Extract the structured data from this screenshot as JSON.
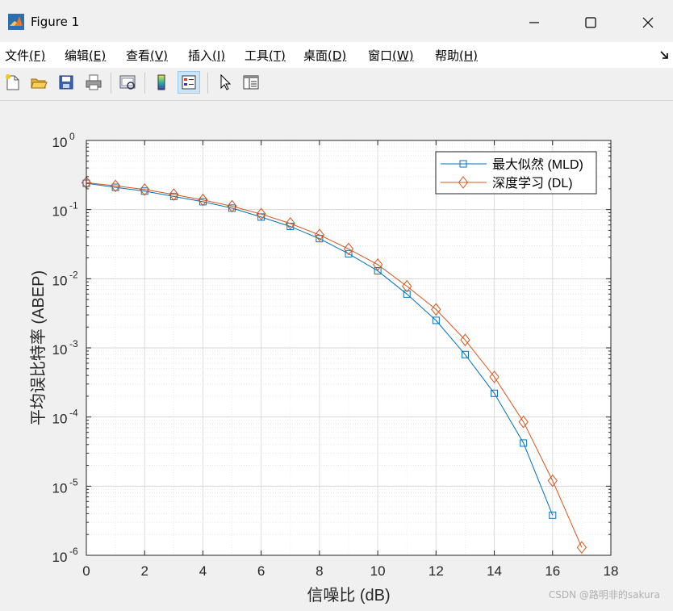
{
  "window": {
    "title": "Figure 1"
  },
  "menu": [
    {
      "label": "文件",
      "key": "(F)"
    },
    {
      "label": "编辑",
      "key": "(E)"
    },
    {
      "label": "查看",
      "key": "(V)"
    },
    {
      "label": "插入",
      "key": "(I)"
    },
    {
      "label": "工具",
      "key": "(T)"
    },
    {
      "label": "桌面",
      "key": "(D)"
    },
    {
      "label": "窗口",
      "key": "(W)"
    },
    {
      "label": "帮助",
      "key": "(H)"
    }
  ],
  "toolbar": {
    "buttons": [
      "new-figure-icon",
      "open-file-icon",
      "save-icon",
      "print-icon",
      "print-preview-icon",
      "colorbar-icon",
      "legend-icon",
      "pointer-icon",
      "property-inspector-icon"
    ],
    "active": "legend-icon"
  },
  "colors": {
    "mld": "#0072BD",
    "dl": "#D95319"
  },
  "chart_data": {
    "type": "line",
    "xlabel": "信噪比 (dB)",
    "ylabel": "平均误比特率 (ABEP)",
    "xlim": [
      0,
      18
    ],
    "ylim": [
      1e-06,
      1
    ],
    "yscale": "log",
    "xticks": [
      "0",
      "2",
      "4",
      "6",
      "8",
      "10",
      "12",
      "14",
      "16",
      "18"
    ],
    "yticks": [
      {
        "base": "10",
        "exp": "0"
      },
      {
        "base": "10",
        "exp": "-1"
      },
      {
        "base": "10",
        "exp": "-2"
      },
      {
        "base": "10",
        "exp": "-3"
      },
      {
        "base": "10",
        "exp": "-4"
      },
      {
        "base": "10",
        "exp": "-5"
      },
      {
        "base": "10",
        "exp": "-6"
      }
    ],
    "grid": true,
    "legend_position": "top-right",
    "series": [
      {
        "name": "最大似然 (MLD)",
        "color": "#0072BD",
        "marker": "square",
        "x": [
          0,
          1,
          2,
          3,
          4,
          5,
          6,
          7,
          8,
          9,
          10,
          11,
          12,
          13,
          14,
          15,
          16
        ],
        "y": [
          0.24,
          0.21,
          0.185,
          0.155,
          0.13,
          0.105,
          0.078,
          0.057,
          0.038,
          0.023,
          0.013,
          0.006,
          0.0025,
          0.0008,
          0.00022,
          4.2e-05,
          3.8e-06
        ]
      },
      {
        "name": "深度学习 (DL)",
        "color": "#D95319",
        "marker": "diamond",
        "x": [
          0,
          1,
          2,
          3,
          4,
          5,
          6,
          7,
          8,
          9,
          10,
          11,
          12,
          13,
          14,
          15,
          16,
          17
        ],
        "y": [
          0.245,
          0.22,
          0.195,
          0.165,
          0.138,
          0.112,
          0.086,
          0.063,
          0.043,
          0.027,
          0.016,
          0.0078,
          0.0036,
          0.0013,
          0.00038,
          8.5e-05,
          1.2e-05,
          1.3e-06
        ]
      }
    ]
  },
  "watermark": "CSDN @路明非的sakura"
}
